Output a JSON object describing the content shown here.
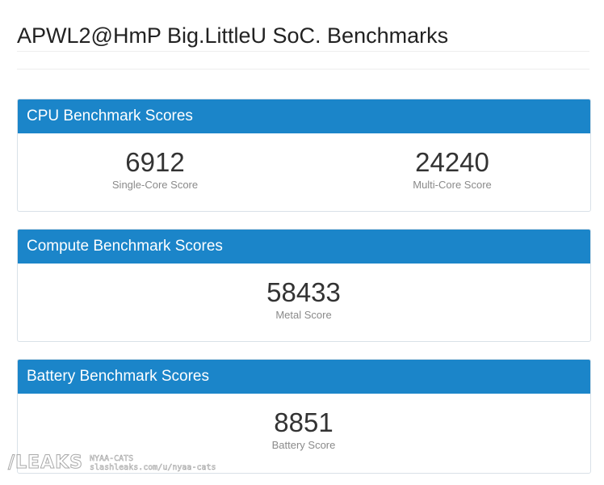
{
  "page": {
    "title": "APWL2@HmP Big.LittleU SoC. Benchmarks"
  },
  "panels": {
    "cpu": {
      "heading": "CPU Benchmark Scores",
      "single_core": {
        "value": "6912",
        "label": "Single-Core Score"
      },
      "multi_core": {
        "value": "24240",
        "label": "Multi-Core Score"
      }
    },
    "compute": {
      "heading": "Compute Benchmark Scores",
      "metal": {
        "value": "58433",
        "label": "Metal Score"
      }
    },
    "battery": {
      "heading": "Battery Benchmark Scores",
      "battery": {
        "value": "8851",
        "label": "Battery Score"
      }
    }
  },
  "watermark": {
    "logo": "/LEAKS",
    "user": "NYAA-CATS",
    "url": "slashleaks.com/u/nyaa-cats"
  },
  "colors": {
    "panel_header": "#1b85c9",
    "panel_header_text": "#ffffff",
    "score_text": "#333333",
    "label_text": "#8a8a8a"
  }
}
